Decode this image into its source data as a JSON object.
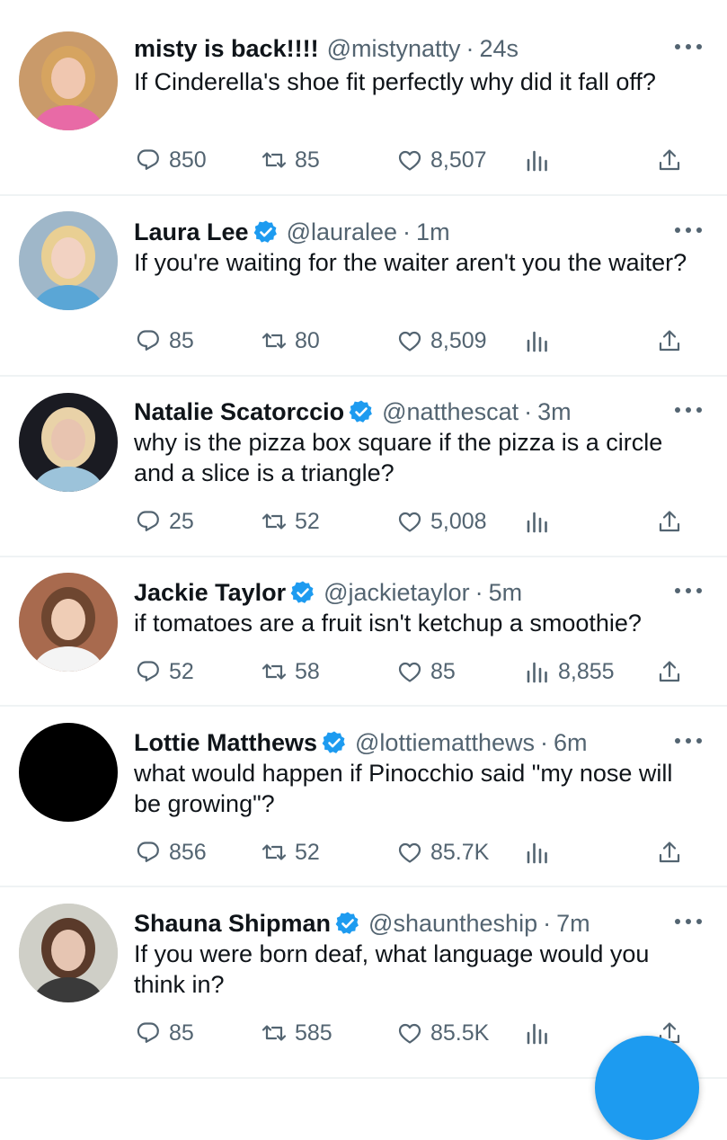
{
  "tweets": [
    {
      "name": "misty is back!!!!",
      "verified": false,
      "handle": "@mistynatty",
      "time": "24s",
      "text": "If Cinderella's shoe fit perfectly why did it fall off?",
      "replies": "850",
      "retweets": "85",
      "likes": "8,507",
      "views": ""
    },
    {
      "name": "Laura Lee",
      "verified": true,
      "handle": "@lauralee",
      "time": "1m",
      "text": "If you're waiting for the waiter aren't you the waiter?",
      "replies": "85",
      "retweets": "80",
      "likes": "8,509",
      "views": ""
    },
    {
      "name": "Natalie Scatorccio",
      "verified": true,
      "handle": "@natthescat",
      "time": "3m",
      "text": "why is the pizza box square if the pizza is a circle and a slice is a triangle?",
      "replies": "25",
      "retweets": "52",
      "likes": "5,008",
      "views": ""
    },
    {
      "name": "Jackie Taylor",
      "verified": true,
      "handle": "@jackietaylor",
      "time": "5m",
      "text": "if tomatoes are a fruit isn't ketchup a smoothie?",
      "replies": "52",
      "retweets": "58",
      "likes": "85",
      "views": "8,855"
    },
    {
      "name": "Lottie Matthews",
      "verified": true,
      "handle": "@lottiematthews",
      "time": "6m",
      "text": "what would happen if Pinocchio said \"my nose will be growing\"?",
      "replies": "856",
      "retweets": "52",
      "likes": "85.7K",
      "views": ""
    },
    {
      "name": "Shauna Shipman",
      "verified": true,
      "handle": "@shauntheship",
      "time": "7m",
      "text": "If you were born deaf, what language would you think in?",
      "replies": "85",
      "retweets": "585",
      "likes": "85.5K",
      "views": ""
    }
  ],
  "separator": "·",
  "colors": {
    "accent": "#1d9bf0",
    "text": "#0f1419",
    "secondary": "#536471",
    "divider": "#eff3f4"
  },
  "icons": {
    "reply": "reply-icon",
    "retweet": "retweet-icon",
    "like": "like-icon",
    "views": "views-icon",
    "share": "share-icon",
    "more": "more-icon",
    "verified": "verified-badge-icon",
    "compose": "compose-button"
  }
}
